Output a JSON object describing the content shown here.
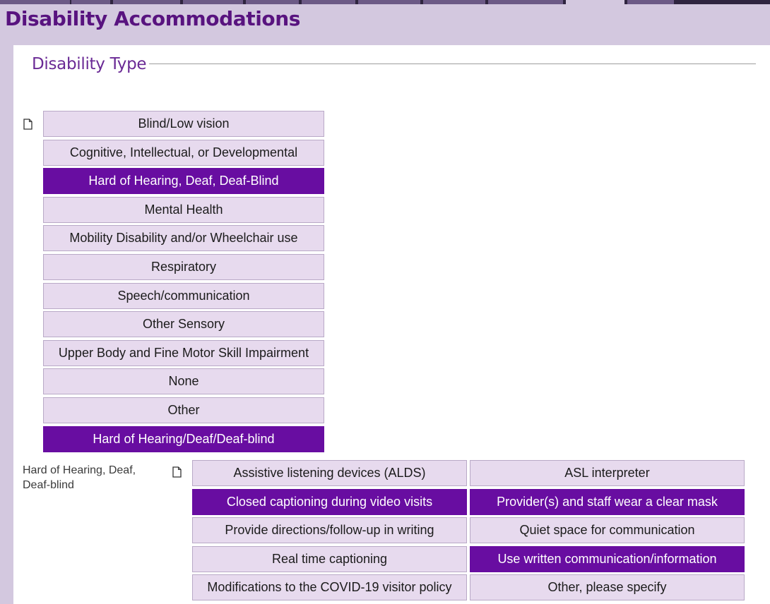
{
  "header": {
    "title": "Disability Accommodations"
  },
  "section": {
    "legend": "Disability Type"
  },
  "icons": {
    "type_note": "document-icon",
    "accom_note": "document-icon"
  },
  "colors": {
    "selected": "#680da1",
    "unselected": "#e7daee",
    "header_text": "#58137f",
    "background": "#d3c8df"
  },
  "disability_types": [
    {
      "label": "Blind/Low vision",
      "selected": false
    },
    {
      "label": "Cognitive, Intellectual, or Developmental",
      "selected": false
    },
    {
      "label": "Hard of Hearing, Deaf, Deaf-Blind",
      "selected": true
    },
    {
      "label": "Mental Health",
      "selected": false
    },
    {
      "label": "Mobility Disability and/or Wheelchair use",
      "selected": false
    },
    {
      "label": "Respiratory",
      "selected": false
    },
    {
      "label": "Speech/communication",
      "selected": false
    },
    {
      "label": "Other Sensory",
      "selected": false
    },
    {
      "label": "Upper Body and Fine Motor Skill Impairment",
      "selected": false
    },
    {
      "label": "None",
      "selected": false
    },
    {
      "label": "Other",
      "selected": false
    },
    {
      "label": "Hard of Hearing/Deaf/Deaf-blind",
      "selected": true
    }
  ],
  "subsection": {
    "label": "Hard of Hearing, Deaf, Deaf-blind",
    "options": [
      {
        "label": "Assistive listening devices (ALDS)",
        "selected": false
      },
      {
        "label": "ASL interpreter",
        "selected": false
      },
      {
        "label": "Closed captioning during video visits",
        "selected": true
      },
      {
        "label": "Provider(s) and staff wear a clear mask",
        "selected": true
      },
      {
        "label": "Provide directions/follow-up in writing",
        "selected": false
      },
      {
        "label": "Quiet space for communication",
        "selected": false
      },
      {
        "label": "Real time captioning",
        "selected": false
      },
      {
        "label": "Use written communication/information",
        "selected": true
      },
      {
        "label": "Modifications to the COVID-19 visitor policy",
        "selected": false
      },
      {
        "label": "Other, please specify",
        "selected": false
      }
    ]
  }
}
